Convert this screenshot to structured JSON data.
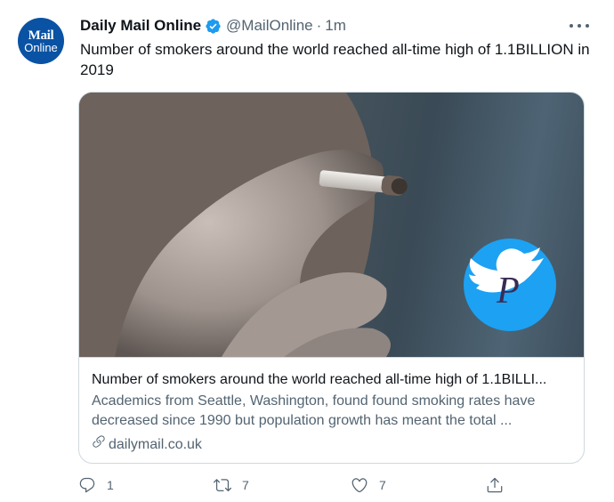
{
  "account": {
    "avatar_line1": "Mail",
    "avatar_line2": "Online",
    "name": "Daily Mail Online",
    "handle": "@MailOnline",
    "separator": "·",
    "time": "1m"
  },
  "tweet": {
    "text": "Number of smokers around the world reached all-time high of 1.1BILLION in 2019"
  },
  "card": {
    "title": "Number of smokers around the world reached all-time high of 1.1BILLI...",
    "description": "Academics from Seattle, Washington, found found smoking rates have decreased since 1990 but population growth has meant the total ...",
    "domain": "dailymail.co.uk",
    "watermark_letter": "P"
  },
  "actions": {
    "reply_count": "1",
    "retweet_count": "7",
    "like_count": "7"
  },
  "colors": {
    "verified": "#1d9bf0",
    "avatar_bg": "#0a52a3",
    "secondary_text": "#536471"
  }
}
